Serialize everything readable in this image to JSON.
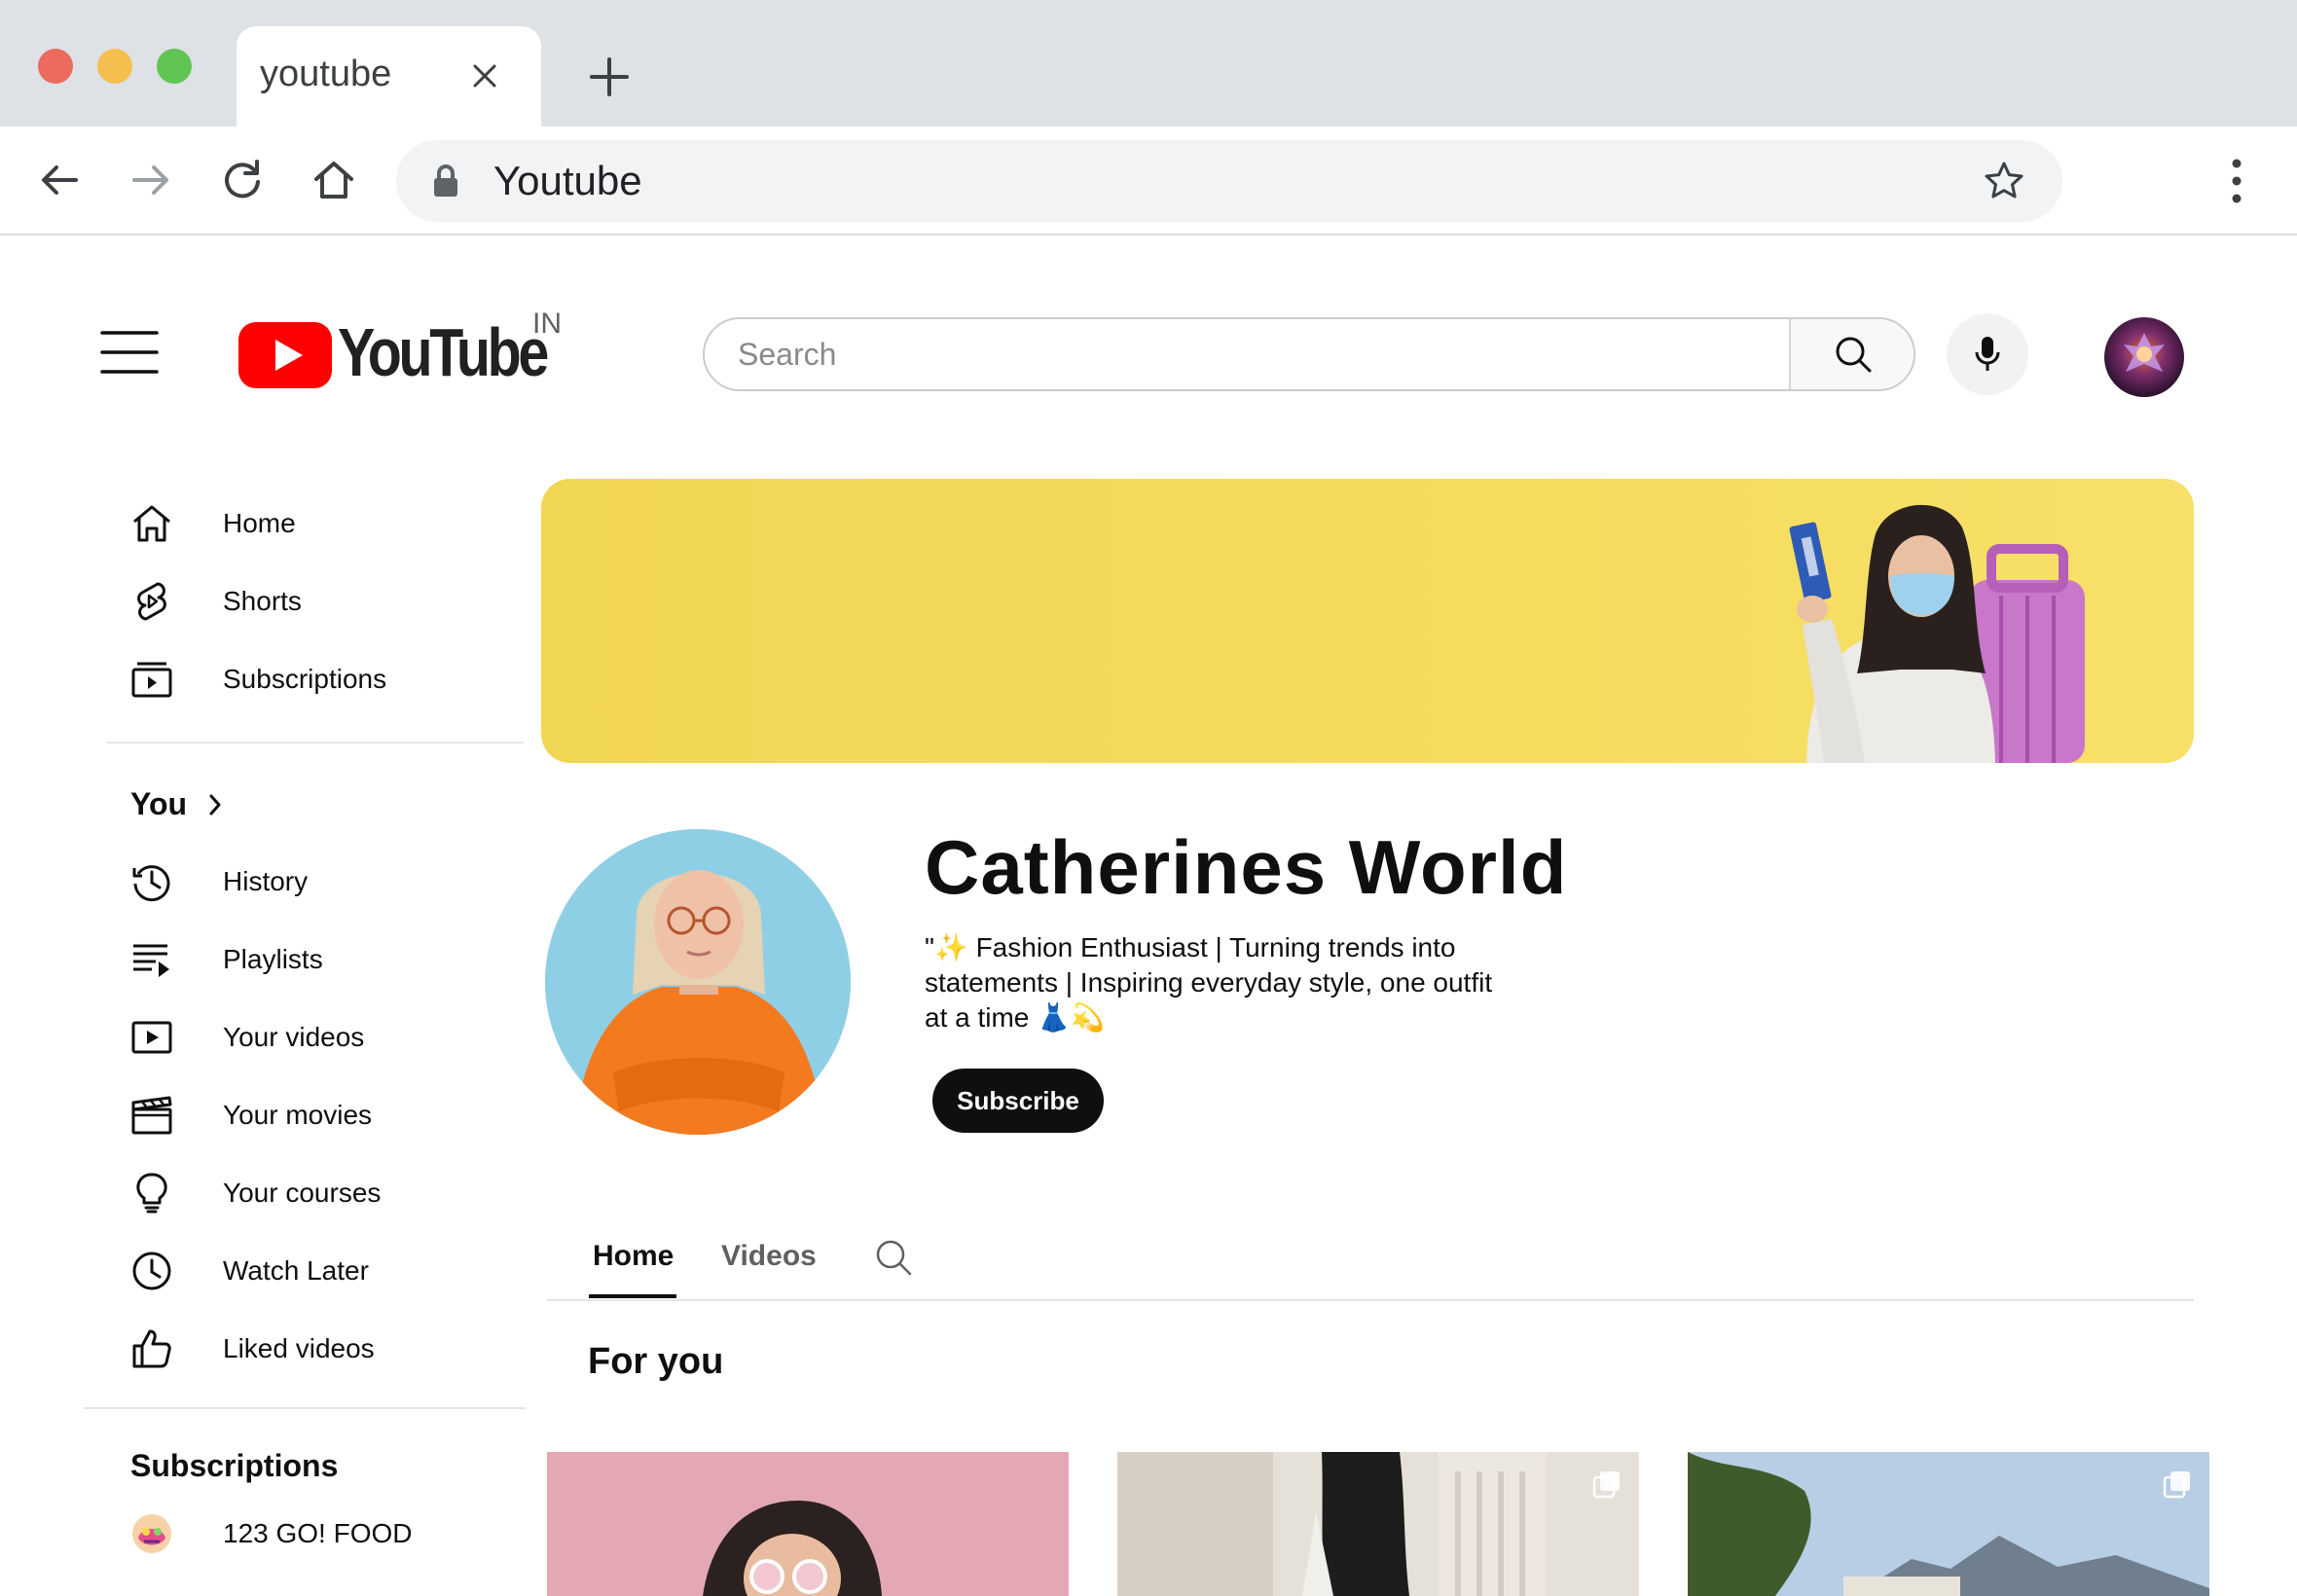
{
  "browser": {
    "tab_title": "youtube",
    "url_text": "Youtube",
    "icons": [
      "close-icon",
      "plus-icon",
      "back-arrow-icon",
      "forward-arrow-icon",
      "reload-icon",
      "home-icon",
      "lock-icon",
      "star-icon",
      "kebab-menu-icon"
    ]
  },
  "header": {
    "logo_text": "YouTube",
    "region": "IN",
    "search_placeholder": "Search",
    "brand_color": "#ff0000"
  },
  "sidebar": {
    "main_items": [
      {
        "label": "Home",
        "icon": "home-icon"
      },
      {
        "label": "Shorts",
        "icon": "shorts-icon"
      },
      {
        "label": "Subscriptions",
        "icon": "subscriptions-icon"
      }
    ],
    "you_heading": "You",
    "you_items": [
      {
        "label": "History",
        "icon": "history-icon"
      },
      {
        "label": "Playlists",
        "icon": "playlists-icon"
      },
      {
        "label": "Your videos",
        "icon": "your-videos-icon"
      },
      {
        "label": "Your movies",
        "icon": "clapperboard-icon"
      },
      {
        "label": "Your courses",
        "icon": "lightbulb-icon"
      },
      {
        "label": "Watch Later",
        "icon": "clock-icon"
      },
      {
        "label": "Liked videos",
        "icon": "thumbs-up-icon"
      }
    ],
    "subscriptions_heading": "Subscriptions",
    "subscriptions": [
      {
        "label": "123 GO! FOOD",
        "icon": "channel-avatar-icon",
        "live": true
      }
    ]
  },
  "channel": {
    "name": "Catherines World",
    "description": "\"✨ Fashion Enthusiast | Turning trends into statements | Inspiring everyday style, one outfit at a time 👗💫",
    "subscribe_label": "Subscribe",
    "tabs": [
      "Home",
      "Videos"
    ],
    "active_tab": "Home",
    "section_title": "For you",
    "banner_color": "#f4da5a"
  }
}
